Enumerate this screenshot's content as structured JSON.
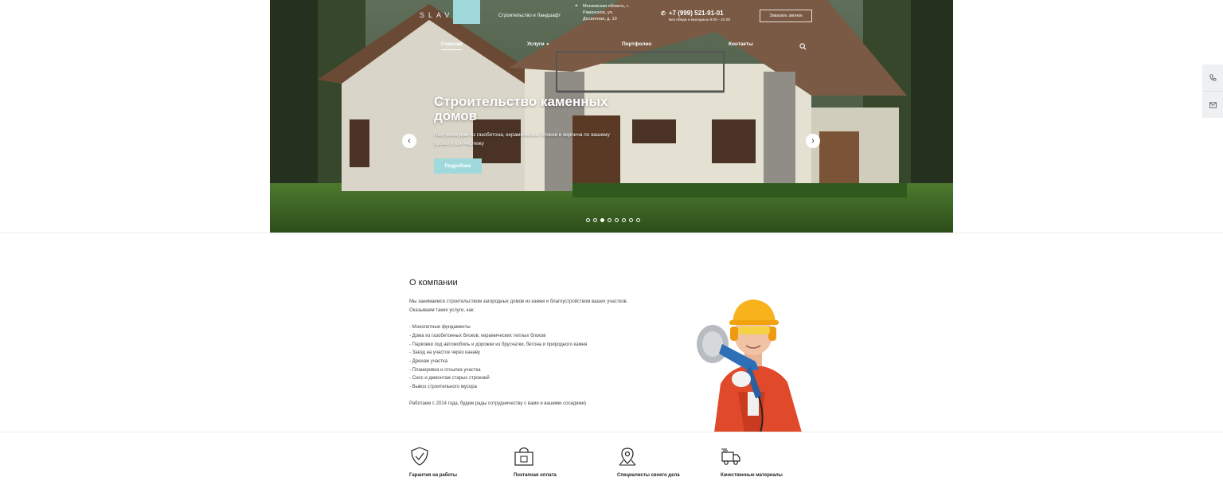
{
  "header": {
    "logo_text": "SLAVS",
    "tagline": "Строительство и Ландшафт",
    "address": "Московская область, г. Раменское, ул. Десантная, д. 10",
    "phone": "+7 (999) 521-91-01",
    "hours": "Без обеда и выходных 8:00 - 22:00",
    "callback_label": "Заказать звонок"
  },
  "nav": {
    "items": [
      {
        "label": "Главная"
      },
      {
        "label": "Услуги"
      },
      {
        "label": "Портфолио"
      },
      {
        "label": "Контакты"
      }
    ]
  },
  "slider": {
    "title": "Строительство каменных домов",
    "text": "Построим дом из газобетона, керамических блоков и кирпича по вашему проекту или чертежу",
    "button_label": "Подробнее",
    "slide_count": 8,
    "active_slide": 3
  },
  "about": {
    "title": "О компании",
    "lines": [
      "Мы занимаемся строительством загородных домов из камня и благоустройством ваших участков.",
      "Оказываем такие услуги, как:",
      "",
      "- Монолитные фундаменты",
      "- Дома из газобетонных блоков, керамических теплых блоков",
      "- Парковки под автомобиль и дорожки из брусчатки, бетона и природного камня",
      "- Заезд на участок через канаву",
      "- Дренаж участка",
      "- Планировка и отсыпка участка",
      "- Снос и демонтаж старых строений",
      "- Вывоз строительного мусора",
      "",
      "Работаем с 2014 года, будем рады сотрудничеству с вами и вашими соседями)"
    ]
  },
  "features": [
    {
      "label": "Гарантия на работы",
      "icon": "shield-check-icon"
    },
    {
      "label": "Поэтапная оплата",
      "icon": "shopping-bag-icon"
    },
    {
      "label": "Специалисты своего дела",
      "icon": "map-pin-icon"
    },
    {
      "label": "Качественные материалы",
      "icon": "delivery-truck-icon"
    }
  ],
  "colors": {
    "accent": "#9fd9dc"
  }
}
